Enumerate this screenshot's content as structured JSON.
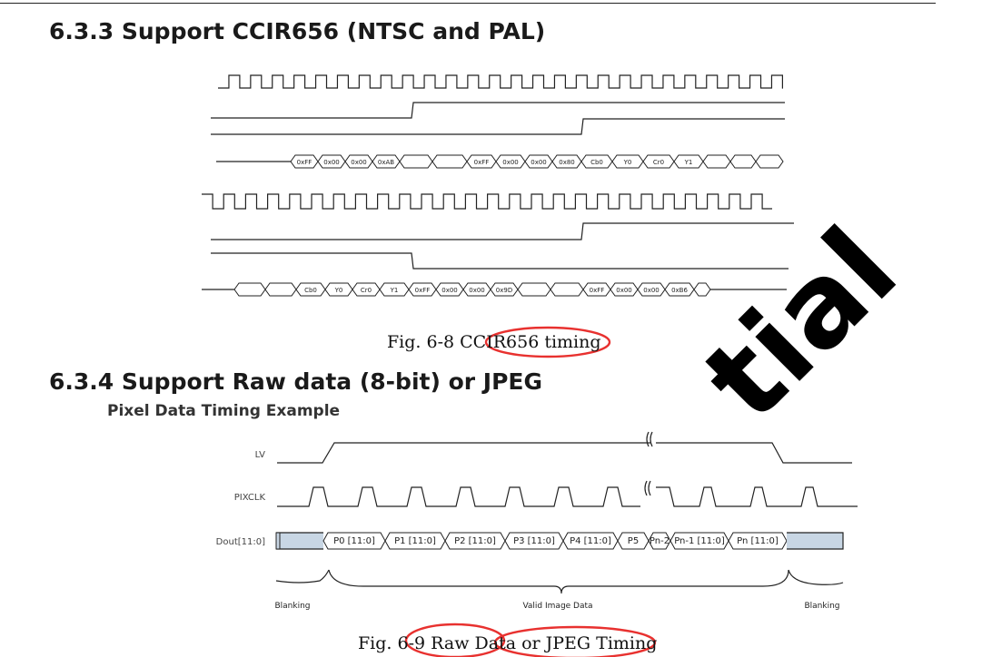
{
  "section_333": {
    "heading": "6.3.3 Support CCIR656 (NTSC and PAL)"
  },
  "fig_68": {
    "caption_prefix": "Fig. 6-8 ",
    "caption_highlight": "CCIR656 timing",
    "row1_labels": [
      "0xFF",
      "0x00",
      "0x00",
      "0xAB",
      "0xFF",
      "0x00",
      "0x00",
      "0x80",
      "Cb0",
      "Y0",
      "Cr0",
      "Y1"
    ],
    "row2_labels": [
      "Cb0",
      "Y0",
      "Cr0",
      "Y1",
      "0xFF",
      "0x00",
      "0x00",
      "0x9D",
      "0xFF",
      "0x00",
      "0x00",
      "0xB6"
    ]
  },
  "section_334": {
    "heading": "6.3.4 Support Raw data (8-bit) or JPEG"
  },
  "fig_69": {
    "subtitle": "Pixel Data Timing Example",
    "signals": [
      "LV",
      "PIXCLK",
      "Dout[11:0]"
    ],
    "pixels": [
      "P0 [11:0]",
      "P1 [11:0]",
      "P2 [11:0]",
      "P3 [11:0]",
      "P4 [11:0]",
      "P5",
      "Pn-2",
      "Pn-1 [11:0]",
      "Pn [11:0]"
    ],
    "brackets": [
      "Blanking",
      "Valid Image Data",
      "Blanking"
    ],
    "caption_prefix": "Fig. 6-",
    "caption_mid": "9 Raw Data",
    "caption_or": " or ",
    "caption_end": "JPEG Timing"
  },
  "watermark": "tial",
  "colors": {
    "highlight": "#e8312f",
    "data_fill": "#c8d6e4",
    "ink": "#222222"
  }
}
